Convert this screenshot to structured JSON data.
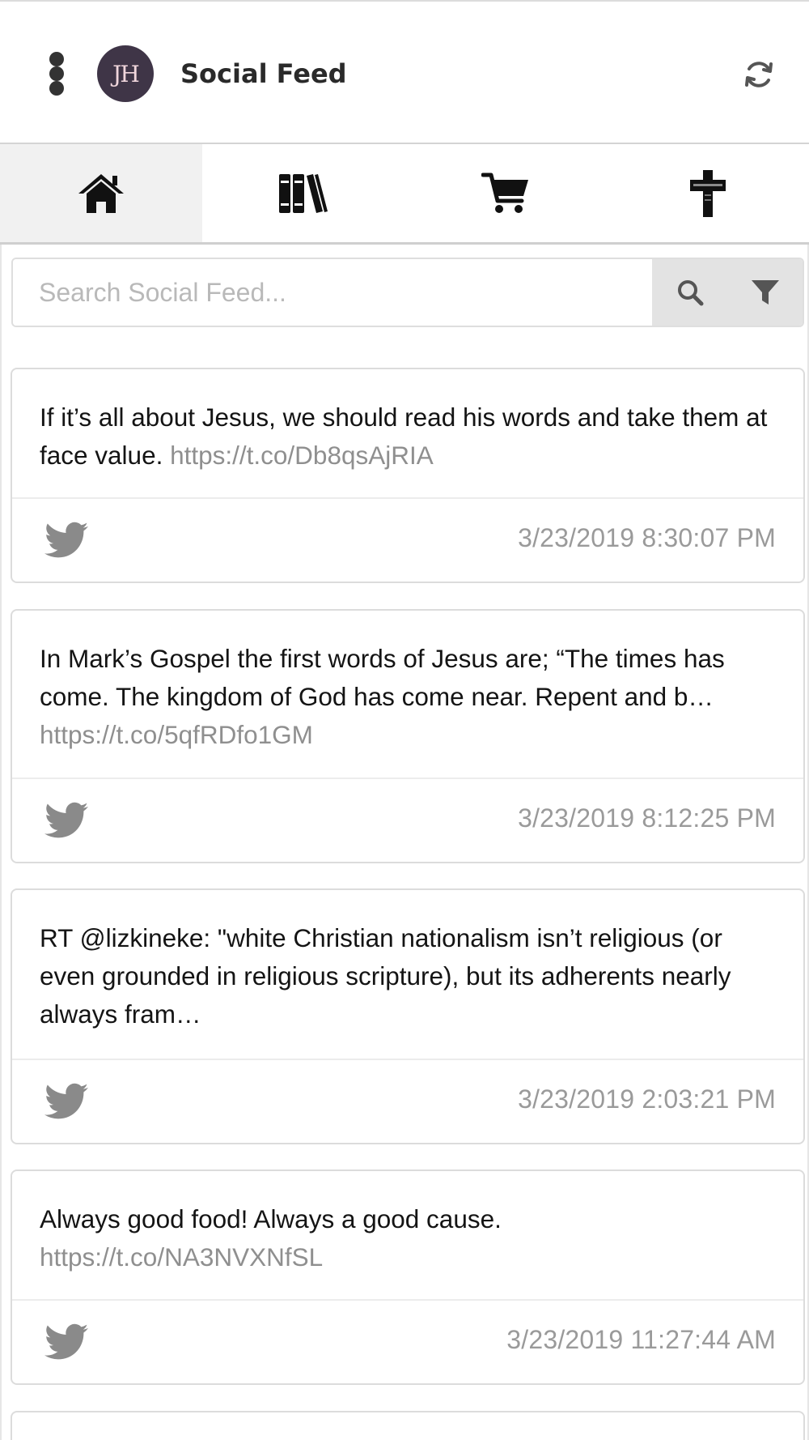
{
  "header": {
    "title": "Social Feed",
    "avatar_initials": "JH",
    "menu_icon": "kebab-menu-icon",
    "refresh_icon": "refresh-icon"
  },
  "tabs": [
    {
      "name": "home",
      "icon": "home-icon",
      "active": true
    },
    {
      "name": "library",
      "icon": "books-icon",
      "active": false
    },
    {
      "name": "shop",
      "icon": "cart-icon",
      "active": false
    },
    {
      "name": "church",
      "icon": "cross-icon",
      "active": false
    }
  ],
  "search": {
    "placeholder": "Search Social Feed...",
    "value": "",
    "search_icon": "search-icon",
    "filter_icon": "filter-icon"
  },
  "feed": [
    {
      "text": "If it’s all about Jesus, we should read his words and take them at face value. ",
      "link": "https://t.co/Db8qsAjRIA",
      "source_icon": "twitter-icon",
      "timestamp": "3/23/2019 8:30:07 PM"
    },
    {
      "text": "In Mark’s Gospel the first words of Jesus are; “The times has come. The kingdom of God has come near. Repent and b… ",
      "link": "https://t.co/5qfRDfo1GM",
      "source_icon": "twitter-icon",
      "timestamp": "3/23/2019 8:12:25 PM"
    },
    {
      "text": "RT @lizkineke: \"white Christian nationalism isn’t religious (or even grounded in religious scripture), but its adherents nearly always fram…",
      "link": "",
      "source_icon": "twitter-icon",
      "timestamp": "3/23/2019 2:03:21 PM"
    },
    {
      "text": "Always good food! Always a good cause. ",
      "link": "https://t.co/NA3NVXNfSL",
      "source_icon": "twitter-icon",
      "timestamp": "3/23/2019 11:27:44 AM"
    }
  ]
}
